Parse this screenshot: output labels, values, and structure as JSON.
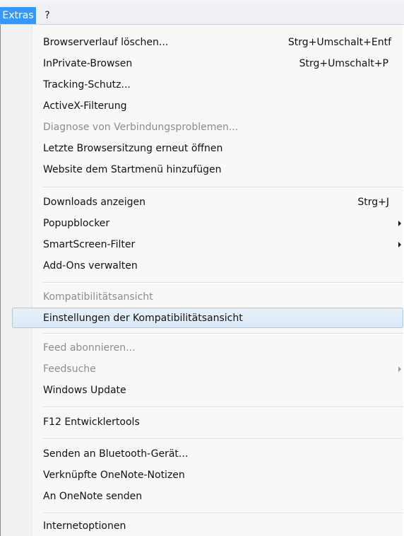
{
  "menubar": {
    "tabs": [
      {
        "label": "Extras"
      },
      {
        "label": "?"
      }
    ]
  },
  "menu": {
    "items": [
      {
        "label": "Browserverlauf löschen...",
        "shortcut": "Strg+Umschalt+Entf"
      },
      {
        "label": "InPrivate-Browsen",
        "shortcut": "Strg+Umschalt+P"
      },
      {
        "label": "Tracking-Schutz..."
      },
      {
        "label": "ActiveX-Filterung"
      },
      {
        "label": "Diagnose von Verbindungsproblemen...",
        "disabled": true
      },
      {
        "label": "Letzte Browsersitzung erneut öffnen"
      },
      {
        "label": "Website dem Startmenü hinzufügen"
      },
      {
        "label": "Downloads anzeigen",
        "shortcut": "Strg+J"
      },
      {
        "label": "Popupblocker",
        "submenu": true
      },
      {
        "label": "SmartScreen-Filter",
        "submenu": true
      },
      {
        "label": "Add-Ons verwalten"
      },
      {
        "label": "Kompatibilitätsansicht",
        "disabled": true
      },
      {
        "label": "Einstellungen der Kompatibilitätsansicht",
        "highlighted": true
      },
      {
        "label": "Feed abonnieren...",
        "disabled": true
      },
      {
        "label": "Feedsuche",
        "disabled": true,
        "submenu": true
      },
      {
        "label": "Windows Update"
      },
      {
        "label": "F12 Entwicklertools"
      },
      {
        "label": "Senden an Bluetooth-Gerät..."
      },
      {
        "label": "Verknüpfte OneNote-Notizen"
      },
      {
        "label": "An OneNote senden"
      },
      {
        "label": "Internetoptionen"
      }
    ]
  },
  "colors": {
    "menubar_active": "#3399ff",
    "highlight_border": "#a8c8ea",
    "disabled_text": "#8d8d8d"
  }
}
